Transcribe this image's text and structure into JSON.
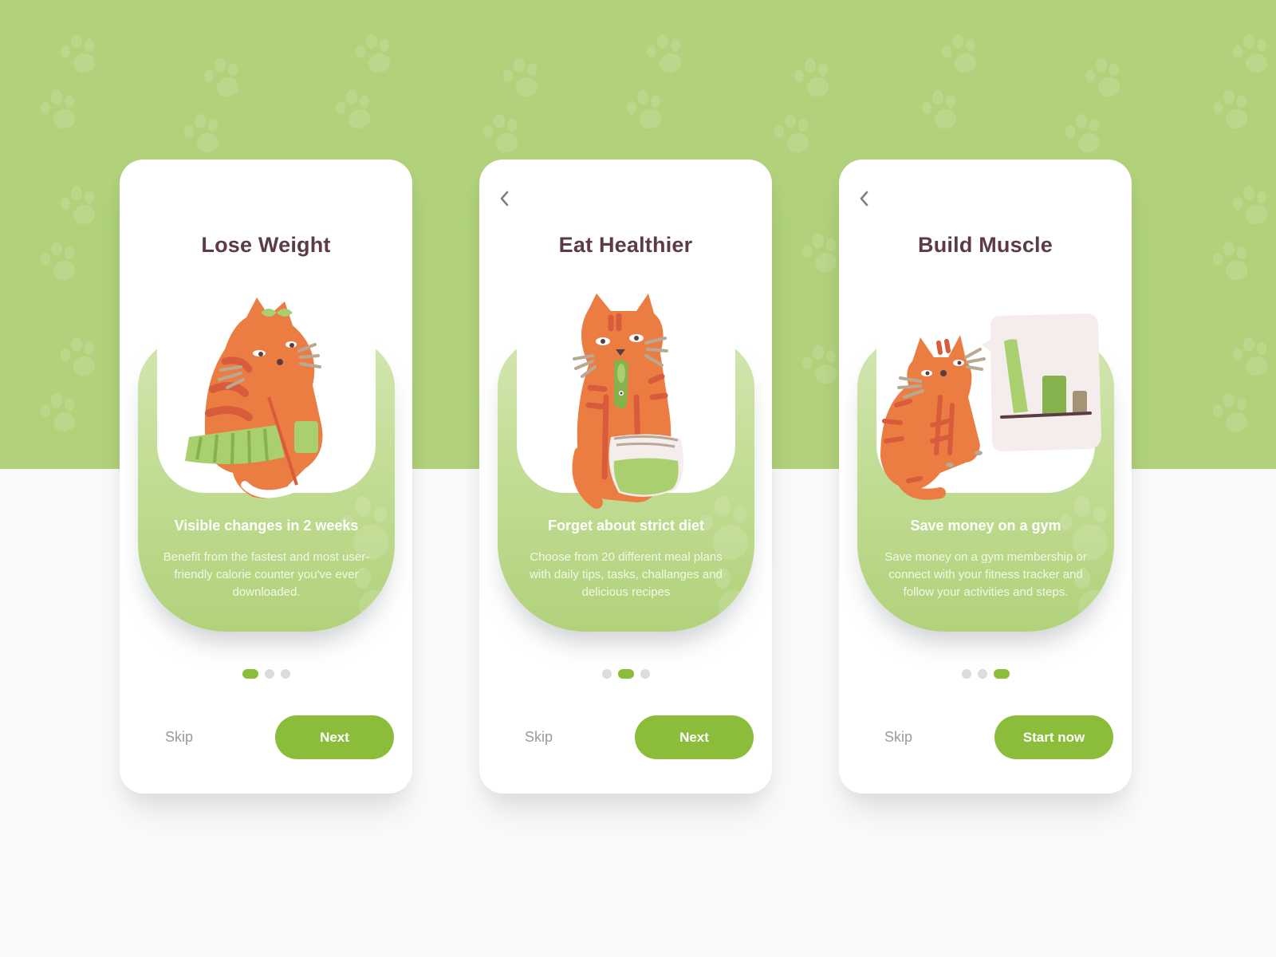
{
  "theme": {
    "header_green": "#b1d27b",
    "accent_green": "#8bbd3a",
    "title_color": "#5c3b43",
    "cat_orange": "#ec7d42",
    "cat_stripe": "#d85b3c",
    "inactive_dot": "#dcdcdc"
  },
  "screens": [
    {
      "show_back": false,
      "title": "Lose Weight",
      "illustration": "cat-in-skirt",
      "subtitle": "Visible changes in 2 weeks",
      "description": "Benefit from the fastest and most user-friendly calorie counter you've ever downloaded.",
      "page_index": 1,
      "page_count": 3,
      "skip_label": "Skip",
      "primary_label": "Next"
    },
    {
      "show_back": true,
      "title": "Eat Healthier",
      "illustration": "cat-with-fish-and-bowl",
      "subtitle": "Forget about strict diet",
      "description": "Choose from 20 different meal plans with daily tips, tasks, challanges and delicious recipes",
      "page_index": 2,
      "page_count": 3,
      "skip_label": "Skip",
      "primary_label": "Next"
    },
    {
      "show_back": true,
      "title": "Build Muscle",
      "illustration": "cat-with-bar-chart",
      "subtitle": "Save money on a gym",
      "description": "Save money on a gym membership or connect with your fitness tracker and follow your activities and steps.",
      "page_index": 3,
      "page_count": 3,
      "skip_label": "Skip",
      "primary_label": "Start now"
    }
  ],
  "icons": {
    "back": "chevron-left-icon",
    "background_pattern": "paw-print-icon"
  }
}
